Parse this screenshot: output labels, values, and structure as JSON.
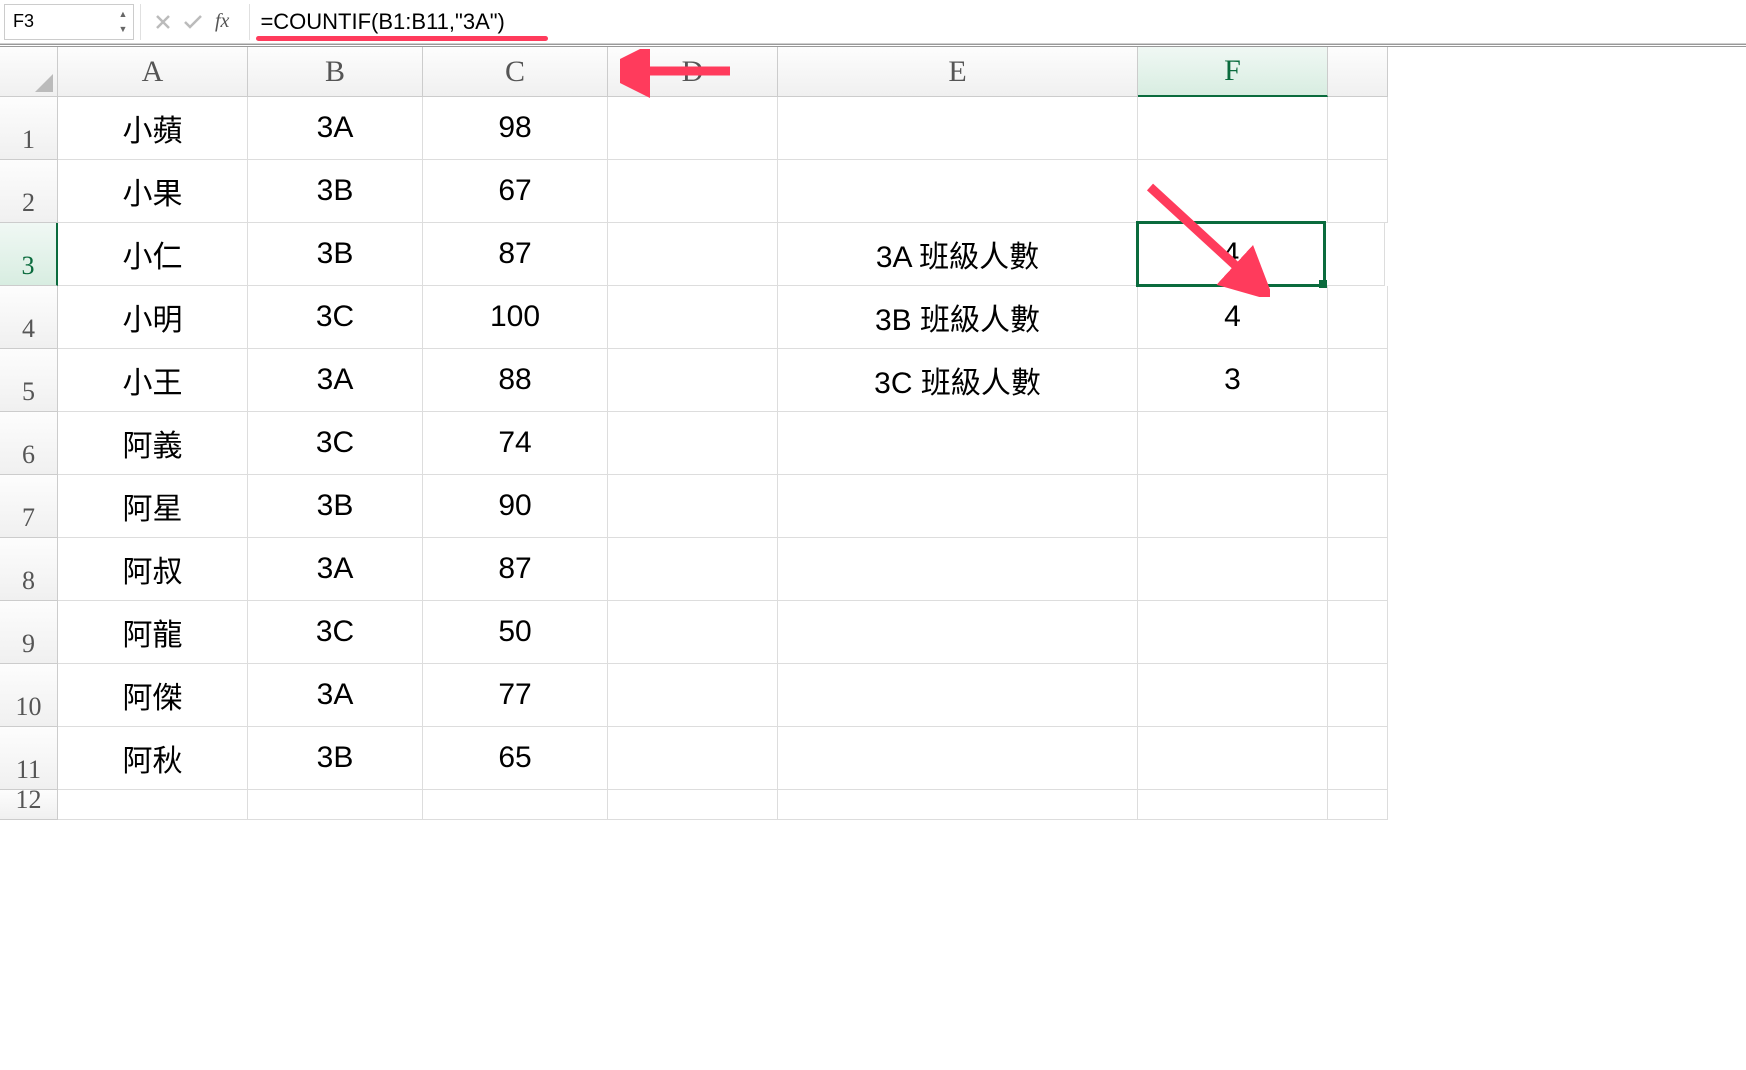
{
  "formula_bar": {
    "cell_ref": "F3",
    "formula": "=COUNTIF(B1:B11,\"3A\")",
    "fx_label": "fx"
  },
  "columns": [
    "A",
    "B",
    "C",
    "D",
    "E",
    "F"
  ],
  "rows": [
    "1",
    "2",
    "3",
    "4",
    "5",
    "6",
    "7",
    "8",
    "9",
    "10",
    "11",
    "12"
  ],
  "active_row": "3",
  "active_col": "F",
  "cells": {
    "A1": "小蘋",
    "B1": "3A",
    "C1": "98",
    "A2": "小果",
    "B2": "3B",
    "C2": "67",
    "A3": "小仁",
    "B3": "3B",
    "C3": "87",
    "A4": "小明",
    "B4": "3C",
    "C4": "100",
    "A5": "小王",
    "B5": "3A",
    "C5": "88",
    "A6": "阿義",
    "B6": "3C",
    "C6": "74",
    "A7": "阿星",
    "B7": "3B",
    "C7": "90",
    "A8": "阿叔",
    "B8": "3A",
    "C8": "87",
    "A9": "阿龍",
    "B9": "3C",
    "C9": "50",
    "A10": "阿傑",
    "B10": "3A",
    "C10": "77",
    "A11": "阿秋",
    "B11": "3B",
    "C11": "65",
    "E3": "3A 班級人數",
    "F3": "4",
    "E4": "3B 班級人數",
    "F4": "4",
    "E5": "3C 班級人數",
    "F5": "3"
  }
}
